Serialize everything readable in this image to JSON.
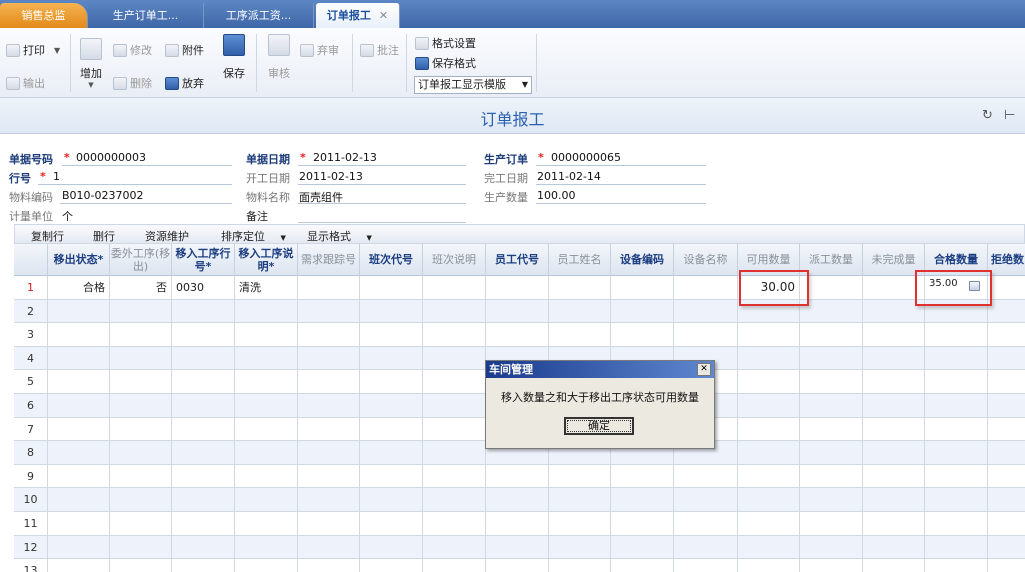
{
  "tabs": [
    {
      "label": "销售总监"
    },
    {
      "label": "生产订单工..."
    },
    {
      "label": "工序派工资..."
    },
    {
      "label": "订单报工"
    }
  ],
  "toolbar": {
    "print": "打印",
    "export": "输出",
    "add": "增加",
    "edit": "修改",
    "attach": "附件",
    "delete": "删除",
    "discard": "放弃",
    "save": "保存",
    "audit": "审核",
    "unaudit": "弃审",
    "annotate": "批注",
    "format_settings": "格式设置",
    "save_format": "保存格式",
    "template_select": "订单报工显示模版"
  },
  "page_title": "订单报工",
  "header": {
    "doc_no_label": "单据号码",
    "doc_no": "0000000003",
    "doc_date_label": "单据日期",
    "doc_date": "2011-02-13",
    "prod_order_label": "生产订单",
    "prod_order": "0000000065",
    "line_no_label": "行号",
    "line_no": "1",
    "start_date_label": "开工日期",
    "start_date": "2011-02-13",
    "finish_date_label": "完工日期",
    "finish_date": "2011-02-14",
    "item_code_label": "物料编码",
    "item_code": "B010-0237002",
    "item_name_label": "物料名称",
    "item_name": "面壳组件",
    "prod_qty_label": "生产数量",
    "prod_qty": "100.00",
    "unit_label": "计量单位",
    "unit": "个",
    "remark_label": "备注"
  },
  "grid_toolbar": {
    "copy_row": "复制行",
    "delete_row": "删行",
    "resource": "资源维护",
    "sort": "排序定位",
    "display_format": "显示格式"
  },
  "grid": {
    "columns": [
      {
        "label": "移出状态*",
        "style": "bold"
      },
      {
        "label": "委外工序(移出)",
        "style": "gray"
      },
      {
        "label": "移入工序行号*",
        "style": "bold"
      },
      {
        "label": "移入工序说明*",
        "style": "bold"
      },
      {
        "label": "需求跟踪号",
        "style": "gray"
      },
      {
        "label": "班次代号",
        "style": "bold"
      },
      {
        "label": "班次说明",
        "style": "gray"
      },
      {
        "label": "员工代号",
        "style": "bold"
      },
      {
        "label": "员工姓名",
        "style": "gray"
      },
      {
        "label": "设备编码",
        "style": "bold"
      },
      {
        "label": "设备名称",
        "style": "gray"
      },
      {
        "label": "可用数量",
        "style": "gray"
      },
      {
        "label": "派工数量",
        "style": "gray"
      },
      {
        "label": "未完成量",
        "style": "gray"
      },
      {
        "label": "合格数量",
        "style": "bold"
      },
      {
        "label": "拒绝数",
        "style": "bold"
      }
    ],
    "rows": [
      [
        "合格",
        "否",
        "0030",
        "清洗",
        "",
        "",
        "",
        "",
        "",
        "",
        "",
        "30.00",
        "",
        "",
        "35.00",
        ""
      ],
      [
        "",
        "",
        "",
        "",
        "",
        "",
        "",
        "",
        "",
        "",
        "",
        "",
        "",
        "",
        "",
        ""
      ],
      [
        "",
        "",
        "",
        "",
        "",
        "",
        "",
        "",
        "",
        "",
        "",
        "",
        "",
        "",
        "",
        ""
      ],
      [
        "",
        "",
        "",
        "",
        "",
        "",
        "",
        "",
        "",
        "",
        "",
        "",
        "",
        "",
        "",
        ""
      ],
      [
        "",
        "",
        "",
        "",
        "",
        "",
        "",
        "",
        "",
        "",
        "",
        "",
        "",
        "",
        "",
        ""
      ],
      [
        "",
        "",
        "",
        "",
        "",
        "",
        "",
        "",
        "",
        "",
        "",
        "",
        "",
        "",
        "",
        ""
      ],
      [
        "",
        "",
        "",
        "",
        "",
        "",
        "",
        "",
        "",
        "",
        "",
        "",
        "",
        "",
        "",
        ""
      ],
      [
        "",
        "",
        "",
        "",
        "",
        "",
        "",
        "",
        "",
        "",
        "",
        "",
        "",
        "",
        "",
        ""
      ],
      [
        "",
        "",
        "",
        "",
        "",
        "",
        "",
        "",
        "",
        "",
        "",
        "",
        "",
        "",
        "",
        ""
      ],
      [
        "",
        "",
        "",
        "",
        "",
        "",
        "",
        "",
        "",
        "",
        "",
        "",
        "",
        "",
        "",
        ""
      ],
      [
        "",
        "",
        "",
        "",
        "",
        "",
        "",
        "",
        "",
        "",
        "",
        "",
        "",
        "",
        "",
        ""
      ],
      [
        "",
        "",
        "",
        "",
        "",
        "",
        "",
        "",
        "",
        "",
        "",
        "",
        "",
        "",
        "",
        ""
      ],
      [
        "",
        "",
        "",
        "",
        "",
        "",
        "",
        "",
        "",
        "",
        "",
        "",
        "",
        "",
        "",
        ""
      ]
    ]
  },
  "dialog": {
    "title": "车间管理",
    "message": "移入数量之和大于移出工序状态可用数量",
    "ok": "确定"
  },
  "colors": {
    "accent_blue": "#2b62b0",
    "tab_orange": "#e38a1a",
    "required_star": "#e02020",
    "highlight_red": "#e03030"
  }
}
